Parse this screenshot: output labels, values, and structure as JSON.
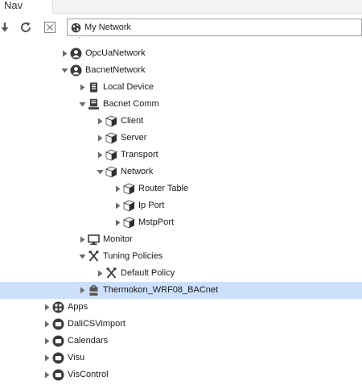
{
  "tab": {
    "label": "Nav"
  },
  "toolbar": {
    "ord_value": "My Network",
    "buttons": [
      "down-arrow-icon",
      "refresh-icon",
      "close-icon"
    ]
  },
  "tree": {
    "rows": [
      {
        "label": "OpcUaNetwork",
        "icon": "network-icon",
        "expanded": false,
        "selected": false
      },
      {
        "label": "BacnetNetwork",
        "icon": "network-icon",
        "expanded": true,
        "selected": false
      },
      {
        "label": "Local Device",
        "icon": "device-icon",
        "expanded": false,
        "selected": false
      },
      {
        "label": "Bacnet Comm",
        "icon": "comm-icon",
        "expanded": true,
        "selected": false
      },
      {
        "label": "Client",
        "icon": "component-icon",
        "expanded": false,
        "selected": false
      },
      {
        "label": "Server",
        "icon": "component-icon",
        "expanded": false,
        "selected": false
      },
      {
        "label": "Transport",
        "icon": "component-icon",
        "expanded": false,
        "selected": false
      },
      {
        "label": "Network",
        "icon": "component-icon",
        "expanded": true,
        "selected": false
      },
      {
        "label": "Router Table",
        "icon": "component-icon",
        "expanded": false,
        "selected": false
      },
      {
        "label": "Ip Port",
        "icon": "component-icon",
        "expanded": false,
        "selected": false
      },
      {
        "label": "MstpPort",
        "icon": "component-icon",
        "expanded": false,
        "selected": false
      },
      {
        "label": "Monitor",
        "icon": "monitor-icon",
        "expanded": false,
        "selected": false
      },
      {
        "label": "Tuning Policies",
        "icon": "tools-icon",
        "expanded": true,
        "selected": false
      },
      {
        "label": "Default Policy",
        "icon": "tools-icon",
        "expanded": false,
        "selected": false
      },
      {
        "label": "Thermokon_WRF08_BACnet",
        "icon": "bacnet-device-icon",
        "expanded": false,
        "selected": true
      },
      {
        "label": "Apps",
        "icon": "apps-icon",
        "expanded": false,
        "selected": false
      },
      {
        "label": "DaliCSVimport",
        "icon": "folder-icon",
        "expanded": false,
        "selected": false
      },
      {
        "label": "Calendars",
        "icon": "folder-icon",
        "expanded": false,
        "selected": false
      },
      {
        "label": "Visu",
        "icon": "folder-icon",
        "expanded": false,
        "selected": false
      },
      {
        "label": "VisControl",
        "icon": "folder-icon",
        "expanded": false,
        "selected": false
      }
    ]
  },
  "colors": {
    "selection": "#cce0fb",
    "arrow": "#6b6b6b",
    "icon_dark": "#3a3a3a"
  }
}
